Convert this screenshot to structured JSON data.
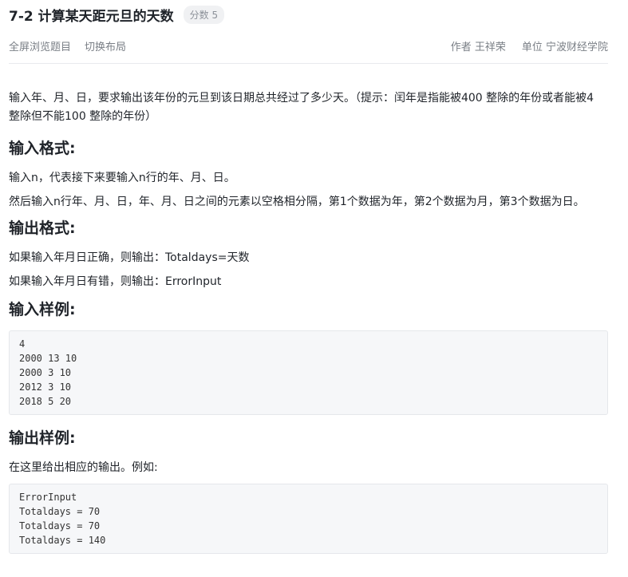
{
  "header": {
    "title": "7-2 计算某天距元旦的天数",
    "score_badge": "分数 5"
  },
  "toolbar": {
    "fullscreen_label": "全屏浏览题目",
    "switch_layout_label": "切换布局",
    "author_label": "作者 王祥荣",
    "unit_label": "单位 宁波财经学院"
  },
  "problem": {
    "description": "输入年、月、日，要求输出该年份的元旦到该日期总共经过了多少天。（提示：闰年是指能被400 整除的年份或者能被4 整除但不能100 整除的年份）",
    "input_format_heading": "输入格式:",
    "input_format_lines": [
      "输入n，代表接下来要输入n行的年、月、日。",
      "然后输入n行年、月、日，年、月、日之间的元素以空格相分隔，第1个数据为年，第2个数据为月，第3个数据为日。"
    ],
    "output_format_heading": "输出格式:",
    "output_format_lines": [
      "如果输入年月日正确，则输出：Totaldays=天数",
      "如果输入年月日有错，则输出：ErrorInput"
    ],
    "input_sample_heading": "输入样例:",
    "input_sample_lines": [
      "4",
      "2000 13 10",
      "2000 3 10",
      "2012 3 10",
      "2018 5 20"
    ],
    "output_sample_heading": "输出样例:",
    "output_sample_intro": "在这里给出相应的输出。例如:",
    "output_sample_lines": [
      "ErrorInput",
      "Totaldays = 70",
      "Totaldays = 70",
      "Totaldays = 140"
    ]
  }
}
